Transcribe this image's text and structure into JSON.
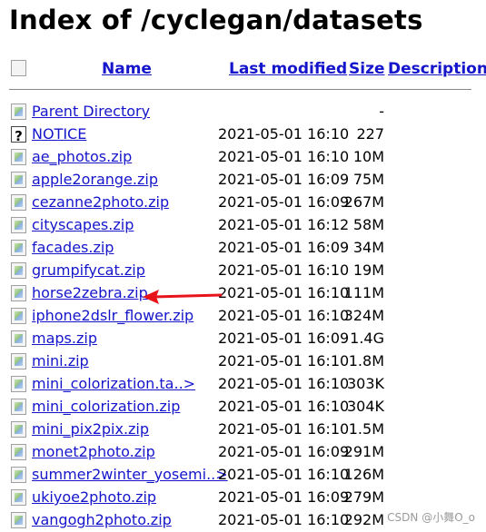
{
  "title": "Index of /cyclegan/datasets",
  "columns": {
    "name": "Name",
    "last_modified": "Last modified",
    "size": "Size",
    "description": "Description"
  },
  "rows": [
    {
      "icon": "back-icon",
      "name": "Parent Directory",
      "date": "",
      "size": "-"
    },
    {
      "icon": "unknown-file-icon",
      "name": "NOTICE",
      "date": "2021-05-01 16:10",
      "size": "227"
    },
    {
      "icon": "archive-icon",
      "name": "ae_photos.zip",
      "date": "2021-05-01 16:10",
      "size": "10M"
    },
    {
      "icon": "archive-icon",
      "name": "apple2orange.zip",
      "date": "2021-05-01 16:09",
      "size": "75M"
    },
    {
      "icon": "archive-icon",
      "name": "cezanne2photo.zip",
      "date": "2021-05-01 16:09",
      "size": "267M"
    },
    {
      "icon": "archive-icon",
      "name": "cityscapes.zip",
      "date": "2021-05-01 16:12",
      "size": "58M"
    },
    {
      "icon": "archive-icon",
      "name": "facades.zip",
      "date": "2021-05-01 16:09",
      "size": "34M"
    },
    {
      "icon": "archive-icon",
      "name": "grumpifycat.zip",
      "date": "2021-05-01 16:10",
      "size": "19M"
    },
    {
      "icon": "archive-icon",
      "name": "horse2zebra.zip",
      "date": "2021-05-01 16:10",
      "size": "111M"
    },
    {
      "icon": "archive-icon",
      "name": "iphone2dslr_flower.zip",
      "date": "2021-05-01 16:10",
      "size": "324M"
    },
    {
      "icon": "archive-icon",
      "name": "maps.zip",
      "date": "2021-05-01 16:09",
      "size": "1.4G"
    },
    {
      "icon": "archive-icon",
      "name": "mini.zip",
      "date": "2021-05-01 16:10",
      "size": "1.8M"
    },
    {
      "icon": "archive-icon",
      "name": "mini_colorization.ta..>",
      "date": "2021-05-01 16:10",
      "size": "303K"
    },
    {
      "icon": "archive-icon",
      "name": "mini_colorization.zip",
      "date": "2021-05-01 16:10",
      "size": "304K"
    },
    {
      "icon": "archive-icon",
      "name": "mini_pix2pix.zip",
      "date": "2021-05-01 16:10",
      "size": "1.5M"
    },
    {
      "icon": "archive-icon",
      "name": "monet2photo.zip",
      "date": "2021-05-01 16:09",
      "size": "291M"
    },
    {
      "icon": "archive-icon",
      "name": "summer2winter_yosemi..>",
      "date": "2021-05-01 16:10",
      "size": "126M"
    },
    {
      "icon": "archive-icon",
      "name": "ukiyoe2photo.zip",
      "date": "2021-05-01 16:09",
      "size": "279M"
    },
    {
      "icon": "archive-icon",
      "name": "vangogh2photo.zip",
      "date": "2021-05-01 16:10",
      "size": "292M"
    }
  ],
  "annotation": {
    "color": "#e8141c",
    "points_to": "horse2zebra.zip"
  },
  "watermark": "CSDN @小舞O_o",
  "colors": {
    "link": "#1515cc",
    "rule": "#888888",
    "arrow": "#e8141c"
  }
}
